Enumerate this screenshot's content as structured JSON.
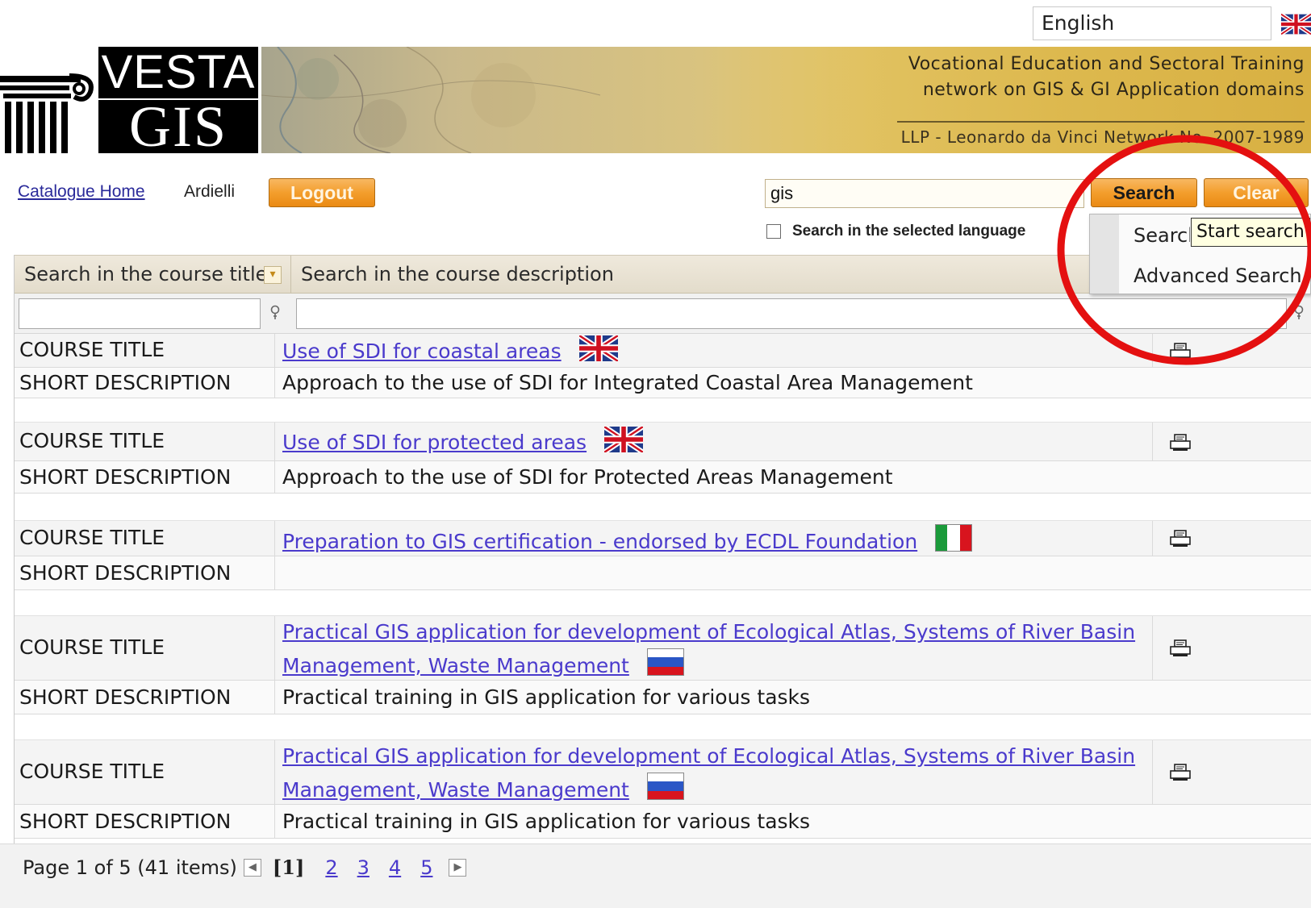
{
  "language": {
    "selected": "English"
  },
  "banner": {
    "logo_top": "VESTA",
    "logo_bottom": "GIS",
    "tagline_line1": "Vocational Education and Sectoral Training",
    "tagline_line2": "network on GIS & GI Application domains",
    "llp_text": "LLP - Leonardo da Vinci Network No. 2007-1989"
  },
  "toolbar": {
    "catalogue_home": "Catalogue Home",
    "user_name": "Ardielli",
    "logout_label": "Logout",
    "search_value": "gis",
    "search_label": "Search",
    "clear_label": "Clear",
    "lang_checkbox_label": "Search in the selected language",
    "lang_checkbox_checked": false
  },
  "search_menu": {
    "items": [
      "Search",
      "Advanced Search"
    ],
    "tooltip": "Start search"
  },
  "grid": {
    "header_title": "Search in the course title",
    "header_desc": "Search in the course description",
    "label_title": "COURSE TITLE",
    "label_desc": "SHORT DESCRIPTION",
    "courses": [
      {
        "title": "Use of SDI for coastal areas",
        "flag": "uk-flag-icon",
        "description": "Approach to the use of SDI for Integrated Coastal Area Management"
      },
      {
        "title": "Use of SDI for protected areas",
        "flag": "uk-flag-icon",
        "description": "Approach to the use of SDI for Protected Areas Management"
      },
      {
        "title": "Preparation to GIS certification - endorsed by ECDL Foundation",
        "flag": "italy-flag-icon",
        "description": ""
      },
      {
        "title_line1": "Practical GIS application for development of Ecological Atlas, Systems of River Basin",
        "title_line2": "Management, Waste Management",
        "flag": "russia-flag-icon",
        "description": "Practical training in GIS application for various tasks"
      },
      {
        "title_line1": "Practical GIS application for development of Ecological Atlas, Systems of River Basin",
        "title_line2": "Management, Waste Management",
        "flag": "russia-flag-icon",
        "description": "Practical training in GIS application for various tasks"
      }
    ]
  },
  "pager": {
    "summary": "Page 1 of 5 (41 items)",
    "current": "[1]",
    "pages": [
      "2",
      "3",
      "4",
      "5"
    ]
  },
  "colors": {
    "accent_orange": "#f39e2c",
    "link": "#4a3acc",
    "annotation_red": "#e41010"
  }
}
